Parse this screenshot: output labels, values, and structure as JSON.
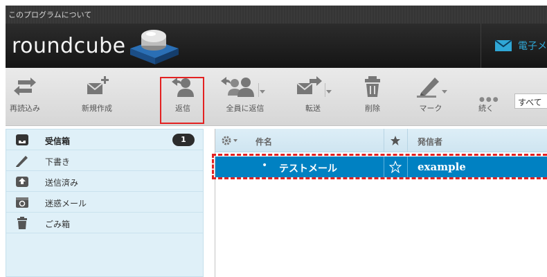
{
  "topbar": {
    "about_label": "このプログラムについて"
  },
  "header": {
    "logo_text": "roundcube",
    "mail_label": "電子メ"
  },
  "toolbar": {
    "buttons": [
      {
        "id": "refresh",
        "label": "再読込み",
        "icon": "refresh-icon"
      },
      {
        "id": "compose",
        "label": "新規作成",
        "icon": "compose-icon"
      },
      {
        "id": "reply",
        "label": "返信",
        "icon": "reply-icon"
      },
      {
        "id": "reply_all",
        "label": "全員に返信",
        "icon": "reply-all-icon"
      },
      {
        "id": "forward",
        "label": "転送",
        "icon": "forward-icon"
      },
      {
        "id": "delete",
        "label": "削除",
        "icon": "trash-icon"
      },
      {
        "id": "mark",
        "label": "マーク",
        "icon": "mark-icon"
      },
      {
        "id": "more",
        "label": "続く",
        "icon": "more-icon"
      }
    ],
    "search_scope": "すべて"
  },
  "folders": [
    {
      "name": "受信箱",
      "icon": "inbox-icon",
      "unread": "1",
      "active": true
    },
    {
      "name": "下書き",
      "icon": "drafts-icon"
    },
    {
      "name": "送信済み",
      "icon": "sent-icon"
    },
    {
      "name": "迷惑メール",
      "icon": "junk-icon"
    },
    {
      "name": "ごみ箱",
      "icon": "trash-icon"
    }
  ],
  "message_list": {
    "columns": {
      "subject": "件名",
      "sender": "発信者"
    },
    "rows": [
      {
        "subject": "テストメール",
        "sender": "example",
        "flagged": false,
        "selected": true
      }
    ]
  },
  "colors": {
    "accent": "#0081c2",
    "highlight": "#e32121",
    "sidebar_bg": "#dff0f8"
  }
}
